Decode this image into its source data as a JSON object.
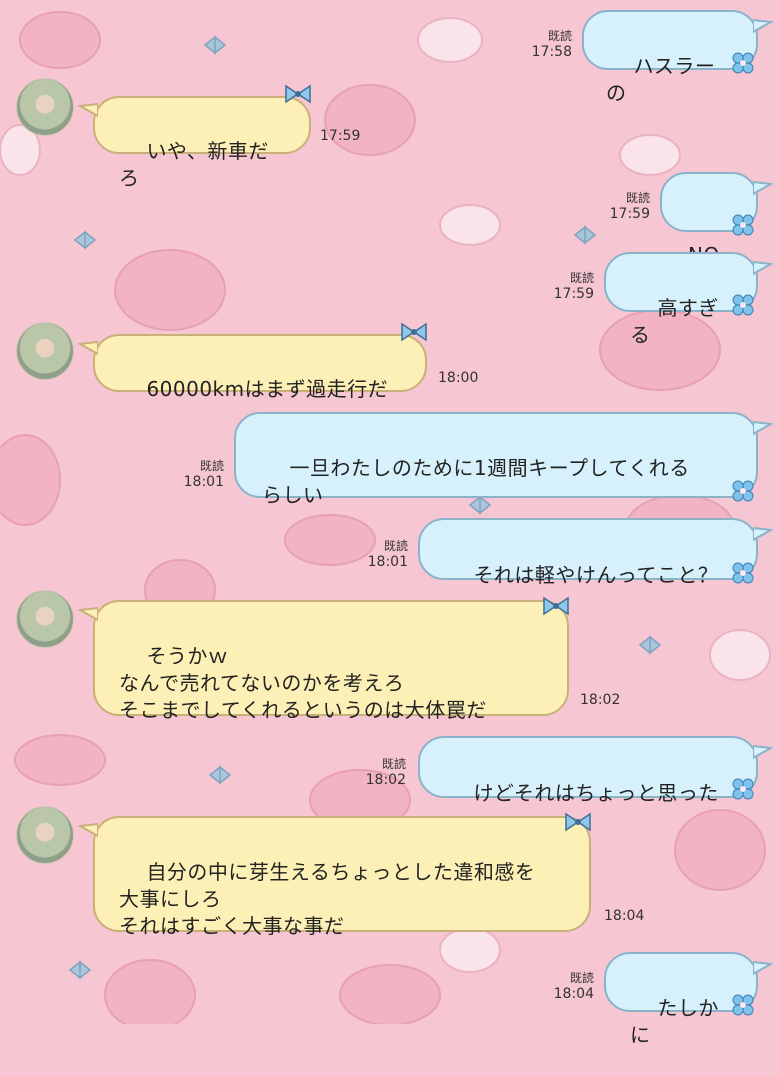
{
  "chat": {
    "messages": [
      {
        "side": "out",
        "text": "ハスラーの",
        "read": "既読",
        "time": "17:58"
      },
      {
        "side": "in",
        "text": "いや、新車だろ",
        "time": "17:59"
      },
      {
        "side": "out",
        "text": "NO",
        "read": "既読",
        "time": "17:59"
      },
      {
        "side": "out",
        "text": "高すぎる",
        "read": "既読",
        "time": "17:59"
      },
      {
        "side": "in",
        "text": "60000kmはまず過走行だ",
        "time": "18:00"
      },
      {
        "side": "out",
        "text": "一旦わたしのために1週間キープしてくれる\nらしい",
        "read": "既読",
        "time": "18:01"
      },
      {
        "side": "out",
        "text": "それは軽やけんってこと？",
        "read": "既読",
        "time": "18:01"
      },
      {
        "side": "in",
        "text": "そうかｗ\nなんで売れてないのかを考えろ\nそこまでしてくれるというのは大体罠だ",
        "time": "18:02"
      },
      {
        "side": "out",
        "text": "けどそれはちょっと思った",
        "read": "既読",
        "time": "18:02"
      },
      {
        "side": "in",
        "text": "自分の中に芽生えるちょっとした違和感を\n大事にしろ\nそれはすごく大事な事だ",
        "time": "18:04"
      },
      {
        "side": "out",
        "text": "たしかに",
        "read": "既読",
        "time": "18:04"
      }
    ]
  },
  "colors": {
    "background": "#f6c6d2",
    "incoming_bubble": "#fdf0b6",
    "outgoing_bubble": "#d6f1fb",
    "bubble_border_out": "#8ab3ca",
    "bubble_border_in": "#c9b07a"
  },
  "icons": {
    "avatar": "contact-avatar-photo",
    "bubble_decor_in": "blue-ribbon-bow-icon",
    "bubble_decor_out": "blue-flower-icon"
  }
}
